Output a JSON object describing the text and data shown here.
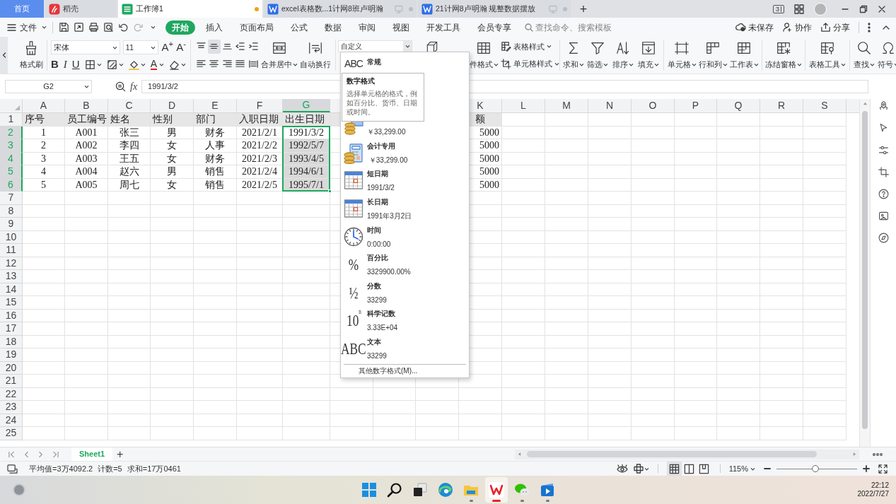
{
  "tabs": [
    {
      "label": "首页",
      "kind": "home",
      "selected": false
    },
    {
      "label": "稻壳",
      "kind": "docer",
      "selected": false
    },
    {
      "label": "工作簿1",
      "kind": "sheet",
      "selected": true,
      "unsaved": true
    },
    {
      "label": "excel表格数...1计网8班卢明瀚",
      "kind": "doc",
      "selected": false,
      "unsaved": false
    },
    {
      "label": "21计网8卢明瀚 规整数据摆放",
      "kind": "doc",
      "selected": false,
      "unsaved": false
    }
  ],
  "new_tab": "+",
  "tablet_mode": "3",
  "menu": {
    "file": "文件",
    "tabs": [
      {
        "label": "开始",
        "selected": true
      },
      {
        "label": "插入",
        "selected": false
      },
      {
        "label": "页面布局",
        "selected": false
      },
      {
        "label": "公式",
        "selected": false
      },
      {
        "label": "数据",
        "selected": false
      },
      {
        "label": "审阅",
        "selected": false
      },
      {
        "label": "视图",
        "selected": false
      },
      {
        "label": "开发工具",
        "selected": false
      },
      {
        "label": "会员专享",
        "selected": false
      }
    ],
    "search": {
      "placeholder": "查找命令、搜索模板"
    },
    "actions": [
      {
        "label": "未保存",
        "kind": "cloud"
      },
      {
        "label": "协作",
        "kind": "person"
      },
      {
        "label": "分享",
        "kind": "share"
      }
    ]
  },
  "ribbon": {
    "format_painter": "格式刷",
    "font_name": "宋体",
    "font_size": "11",
    "size_buttons": [
      "A$^{+}$",
      "A$^{-}$"
    ],
    "font_buttons": [
      {
        "kind": "bold",
        "text": "B"
      },
      {
        "kind": "italic",
        "text": "I"
      },
      {
        "kind": "underline",
        "text": "U"
      },
      {
        "kind": "border"
      },
      {
        "kind": "pattern"
      },
      {
        "kind": "fill"
      },
      {
        "kind": "color",
        "text": "A"
      },
      {
        "kind": "eraser"
      }
    ],
    "alignment": [
      {
        "kind": "top",
        "selected": false
      },
      {
        "kind": "middle",
        "selected": true
      },
      {
        "kind": "bottom",
        "selected": false
      },
      {
        "kind": "outdent",
        "selected": false
      },
      {
        "kind": "indent",
        "selected": false
      },
      {
        "kind": "left",
        "selected": false
      },
      {
        "kind": "center",
        "selected": false
      },
      {
        "kind": "right",
        "selected": false
      },
      {
        "kind": "justify",
        "selected": false
      },
      {
        "kind": "distribute",
        "selected": false
      }
    ],
    "merge": "合并居中",
    "wrap": "自动换行",
    "number_format": "自定义",
    "conditional_format": "件格式",
    "styles": [
      "表格样式",
      "单元格样式"
    ],
    "tools": [
      {
        "label": "求和",
        "kind": "sum"
      },
      {
        "label": "筛选",
        "kind": "filter"
      },
      {
        "label": "排序",
        "kind": "sort"
      },
      {
        "label": "填充",
        "kind": "fill"
      },
      {
        "label": "单元格",
        "kind": "cell"
      },
      {
        "label": "行和列",
        "kind": "rowcol"
      },
      {
        "label": "工作表",
        "kind": "sheet"
      },
      {
        "label": "冻结窗格",
        "kind": "freeze"
      },
      {
        "label": "表格工具",
        "kind": "tools"
      },
      {
        "label": "查找",
        "kind": "find"
      },
      {
        "label": "符号",
        "kind": "symbol"
      }
    ]
  },
  "formula_bar": {
    "name_box": "G2",
    "fx": "fx",
    "value": "1991/3/2"
  },
  "sheet": {
    "columns": [
      {
        "label": "A",
        "selected": false
      },
      {
        "label": "B",
        "selected": false
      },
      {
        "label": "C",
        "selected": false
      },
      {
        "label": "D",
        "selected": false
      },
      {
        "label": "E",
        "selected": false
      },
      {
        "label": "F",
        "selected": false
      },
      {
        "label": "G",
        "selected": true
      },
      {
        "label": "K",
        "selected": false
      },
      {
        "label": "L",
        "selected": false
      },
      {
        "label": "M",
        "selected": false
      },
      {
        "label": "N",
        "selected": false
      },
      {
        "label": "O",
        "selected": false
      },
      {
        "label": "P",
        "selected": false
      },
      {
        "label": "Q",
        "selected": false
      },
      {
        "label": "R",
        "selected": false
      },
      {
        "label": "S",
        "selected": false
      }
    ],
    "rows": [
      {
        "number": "1",
        "selected": false,
        "shaded": true,
        "cells": {
          "A": "序号",
          "B": "员工编号",
          "C": "姓名",
          "D": "性别",
          "E": "部门",
          "F": "入职日期",
          "G": "出生日期",
          "K": "额"
        }
      },
      {
        "number": "2",
        "selected": true,
        "shaded": false,
        "cells": {
          "A": "1",
          "B": "A001",
          "C": "张三",
          "D": "男",
          "E": "财务",
          "F": "2021/2/1",
          "G": "1991/3/2",
          "K": "5000"
        }
      },
      {
        "number": "3",
        "selected": true,
        "shaded": false,
        "cells": {
          "A": "2",
          "B": "A002",
          "C": "李四",
          "D": "女",
          "E": "人事",
          "F": "2021/2/2",
          "G": "1992/5/7",
          "K": "5000"
        }
      },
      {
        "number": "4",
        "selected": true,
        "shaded": false,
        "cells": {
          "A": "3",
          "B": "A003",
          "C": "王五",
          "D": "女",
          "E": "财务",
          "F": "2021/2/3",
          "G": "1993/4/5",
          "K": "5000"
        }
      },
      {
        "number": "5",
        "selected": true,
        "shaded": false,
        "cells": {
          "A": "4",
          "B": "A004",
          "C": "赵六",
          "D": "男",
          "E": "销售",
          "F": "2021/2/4",
          "G": "1994/6/1",
          "K": "5000"
        }
      },
      {
        "number": "6",
        "selected": true,
        "shaded": false,
        "cells": {
          "A": "5",
          "B": "A005",
          "C": "周七",
          "D": "女",
          "E": "销售",
          "F": "2021/2/5",
          "G": "1995/7/1",
          "K": "5000"
        }
      },
      {
        "number": "7",
        "selected": false,
        "shaded": false
      },
      {
        "number": "8",
        "selected": false,
        "shaded": false
      },
      {
        "number": "9",
        "selected": false,
        "shaded": false
      },
      {
        "number": "10",
        "selected": false,
        "shaded": false
      },
      {
        "number": "11",
        "selected": false,
        "shaded": false
      },
      {
        "number": "12",
        "selected": false,
        "shaded": false
      },
      {
        "number": "13",
        "selected": false,
        "shaded": false
      },
      {
        "number": "14",
        "selected": false,
        "shaded": false
      },
      {
        "number": "15",
        "selected": false,
        "shaded": false
      },
      {
        "number": "16",
        "selected": false,
        "shaded": false
      },
      {
        "number": "17",
        "selected": false,
        "shaded": false
      },
      {
        "number": "18",
        "selected": false,
        "shaded": false
      },
      {
        "number": "19",
        "selected": false,
        "shaded": false
      },
      {
        "number": "20",
        "selected": false,
        "shaded": false
      },
      {
        "number": "21",
        "selected": false,
        "shaded": false
      },
      {
        "number": "22",
        "selected": false,
        "shaded": false
      },
      {
        "number": "23",
        "selected": false,
        "shaded": false
      },
      {
        "number": "24",
        "selected": false,
        "shaded": false
      },
      {
        "number": "25",
        "selected": false,
        "shaded": false
      }
    ]
  },
  "number_format_menu": {
    "items": [
      {
        "kind": "glyph-small",
        "glyph": "ABC",
        "label": "常规"
      },
      {
        "kind": "coins",
        "preview": "￥33,299.00"
      },
      {
        "kind": "coins-calc",
        "label": "会计专用",
        "preview": " ￥33,299.00"
      },
      {
        "kind": "calendar",
        "label": "短日期",
        "preview": "1991/3/2"
      },
      {
        "kind": "calendar",
        "label": "长日期",
        "preview": "1991年3月2日"
      },
      {
        "kind": "clock",
        "label": "时间",
        "preview": "0:00:00"
      },
      {
        "kind": "glyph",
        "glyph": "%",
        "label": "百分比",
        "preview": "3329900.00%"
      },
      {
        "kind": "glyph",
        "glyph": "½",
        "label": "分数",
        "preview": "33299"
      },
      {
        "kind": "glyph",
        "glyph": "10$^{n}$",
        "label": "科学记数",
        "preview": "3.33E+04"
      },
      {
        "kind": "glyph",
        "glyph": "ABC",
        "label": "文本",
        "preview": "33299"
      }
    ],
    "more": "其他数字格式(M)...",
    "tooltip": {
      "title": "数字格式",
      "text": "选择单元格的格式，例如百分比、货币、日期或时间。"
    }
  },
  "sheet_tabs": [
    {
      "name": "Sheet1",
      "selected": true
    }
  ],
  "add_sheet": "+",
  "status_bar": {
    "stats": [
      "平均值=3万4092.2",
      "计数=5",
      "求和=17万0461"
    ],
    "view_modes": [
      {
        "kind": "normal",
        "selected": true
      },
      {
        "kind": "page",
        "selected": false
      },
      {
        "kind": "break",
        "selected": false
      }
    ],
    "zoom": {
      "label": "115%",
      "level": 0.48
    }
  },
  "taskbar": {
    "apps": [
      {
        "kind": "start",
        "running": false
      },
      {
        "kind": "search",
        "running": false
      },
      {
        "kind": "task-view",
        "running": false
      },
      {
        "kind": "edge",
        "running": false
      },
      {
        "kind": "explorer",
        "running": true,
        "active": false
      },
      {
        "kind": "wps",
        "running": true,
        "active": true
      },
      {
        "kind": "wechat",
        "running": true,
        "active": false
      },
      {
        "kind": "video",
        "running": true,
        "active": false
      }
    ],
    "time": "22:12",
    "date": "2022/7/27"
  }
}
